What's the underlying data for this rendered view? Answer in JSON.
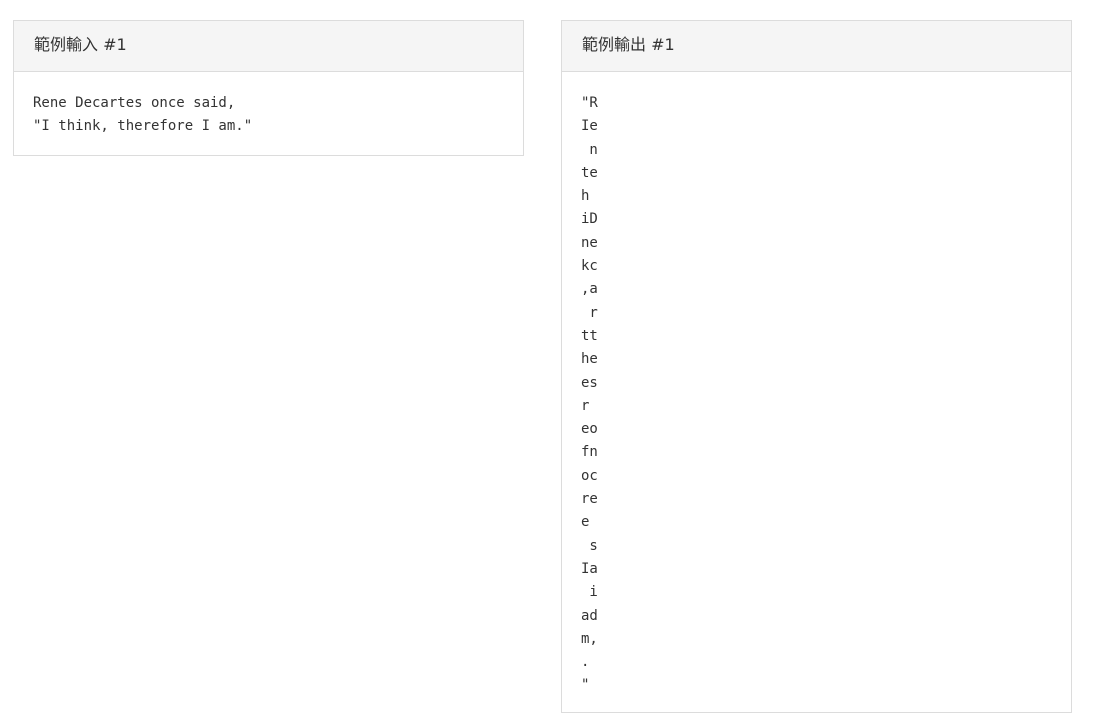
{
  "input_panel": {
    "title": "範例輸入 #1",
    "content": "Rene Decartes once said,\n\"I think, therefore I am.\""
  },
  "output_panel": {
    "title": "範例輸出 #1",
    "content": "\"R\nIe\n n\nte\nh\niD\nne\nkc\n,a\n r\ntt\nhe\nes\nr\neo\nfn\noc\nre\ne\n s\nIa\n i\nad\nm,\n.\n\""
  }
}
